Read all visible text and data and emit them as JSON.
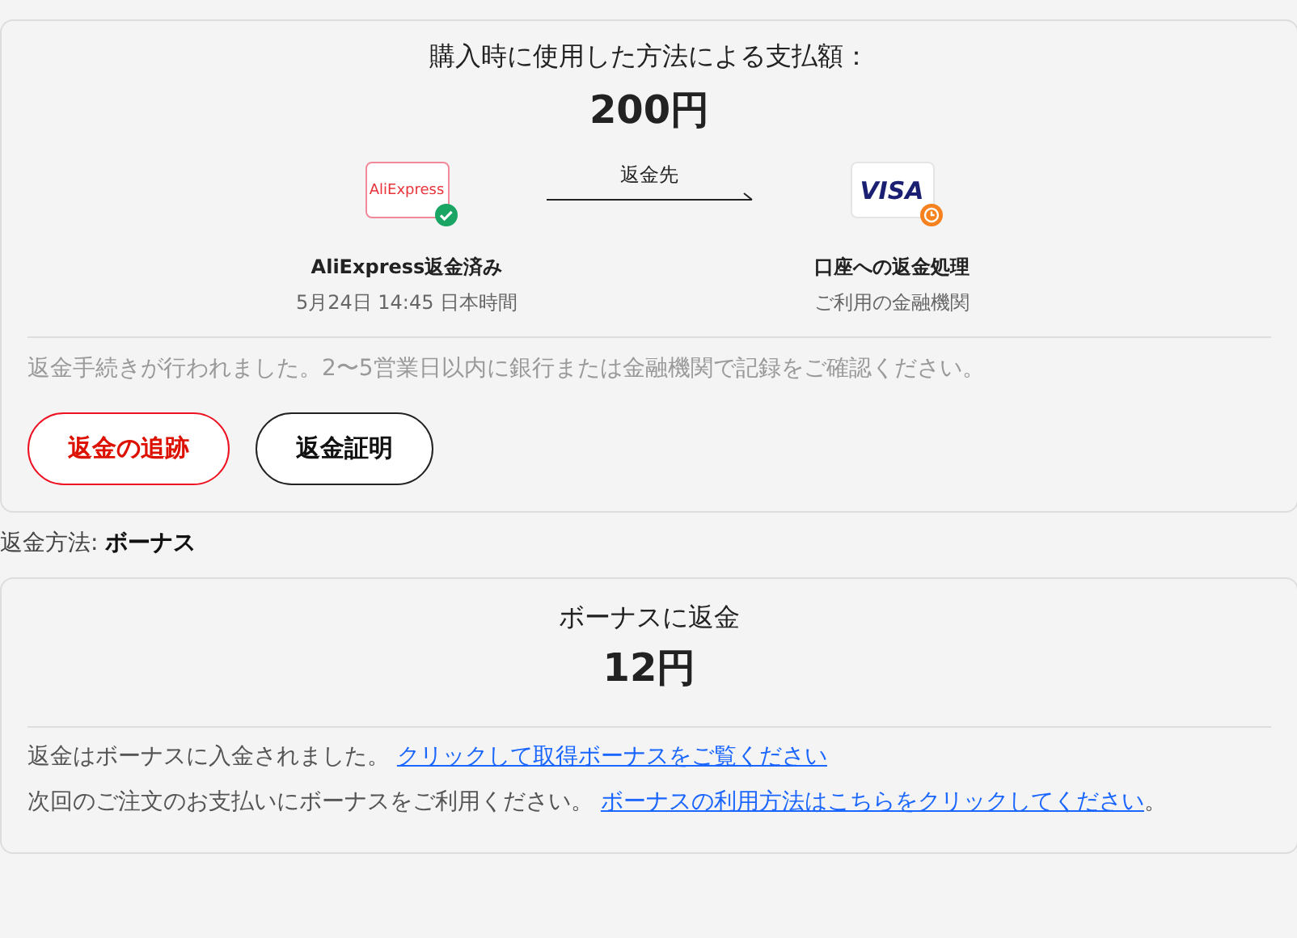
{
  "payment_card": {
    "title": "購入時に使用した方法による支払額：",
    "amount": "200円",
    "flow": {
      "label": "返金先",
      "steps": [
        {
          "logo": "AliExpress",
          "kind": "aliexpress",
          "done": true,
          "title": "AliExpress返金済み",
          "subtitle": "5月24日 14:45 日本時間"
        },
        {
          "logo": "VISA",
          "kind": "visa",
          "done": false,
          "title": "口座への返金処理",
          "subtitle": "ご利用の金融機関"
        }
      ]
    },
    "note": "返金手続きが行われました。2〜5営業日以内に銀行または金融機関で記録をご確認ください。",
    "buttons": [
      {
        "label": "返金の追跡",
        "kind": "primary"
      },
      {
        "label": "返金証明",
        "kind": "outline"
      }
    ]
  },
  "refund_method": {
    "label": "返金方法:",
    "value": "ボーナス"
  },
  "bonus_card": {
    "title": "ボーナスに返金",
    "amount": "12円",
    "lines": [
      {
        "text": "返金はボーナスに入金されました。",
        "link": "クリックして取得ボーナスをご覧ください"
      },
      {
        "text": "次回のご注文のお支払いにボーナスをご利用ください。",
        "link": "ボーナスの利用方法はこちらをクリックしてください",
        "after": "。"
      }
    ]
  }
}
